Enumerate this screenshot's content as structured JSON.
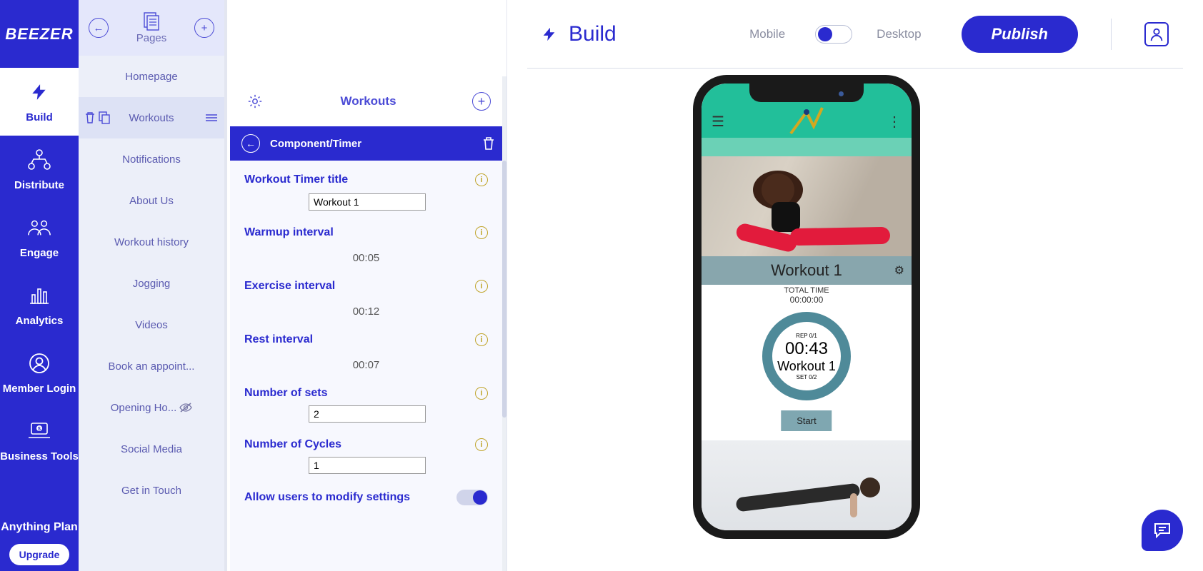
{
  "brand": "BEEZER",
  "main_nav": {
    "items": [
      {
        "label": "Build"
      },
      {
        "label": "Distribute"
      },
      {
        "label": "Engage"
      },
      {
        "label": "Analytics"
      },
      {
        "label": "Member Login"
      },
      {
        "label": "Business Tools"
      }
    ],
    "plan_label": "Anything Plan",
    "upgrade_label": "Upgrade"
  },
  "pages_panel": {
    "title": "Pages",
    "items": [
      {
        "label": "Homepage"
      },
      {
        "label": "Workouts"
      },
      {
        "label": "Notifications"
      },
      {
        "label": "About Us"
      },
      {
        "label": "Workout history"
      },
      {
        "label": "Jogging"
      },
      {
        "label": "Videos"
      },
      {
        "label": "Book an appoint..."
      },
      {
        "label": "Opening Ho..."
      },
      {
        "label": "Social Media"
      },
      {
        "label": "Get in Touch"
      }
    ]
  },
  "editor": {
    "page_title": "Workouts",
    "component_name": "Component/Timer",
    "fields": {
      "title_label": "Workout Timer title",
      "title_value": "Workout 1",
      "warmup_label": "Warmup interval",
      "warmup_value": "00:05",
      "exercise_label": "Exercise interval",
      "exercise_value": "00:12",
      "rest_label": "Rest interval",
      "rest_value": "00:07",
      "sets_label": "Number of sets",
      "sets_value": "2",
      "cycles_label": "Number of Cycles",
      "cycles_value": "1",
      "allow_modify_label": "Allow users to modify settings"
    }
  },
  "preview": {
    "build_label": "Build",
    "mobile_label": "Mobile",
    "desktop_label": "Desktop",
    "publish_label": "Publish"
  },
  "phone": {
    "workout_title": "Workout 1",
    "total_time_label": "TOTAL TIME",
    "total_time_value": "00:00:00",
    "rep_label": "REP 0/1",
    "timer_value": "00:43",
    "timer_name": "Workout 1",
    "set_label": "SET 0/2",
    "start_label": "Start"
  }
}
